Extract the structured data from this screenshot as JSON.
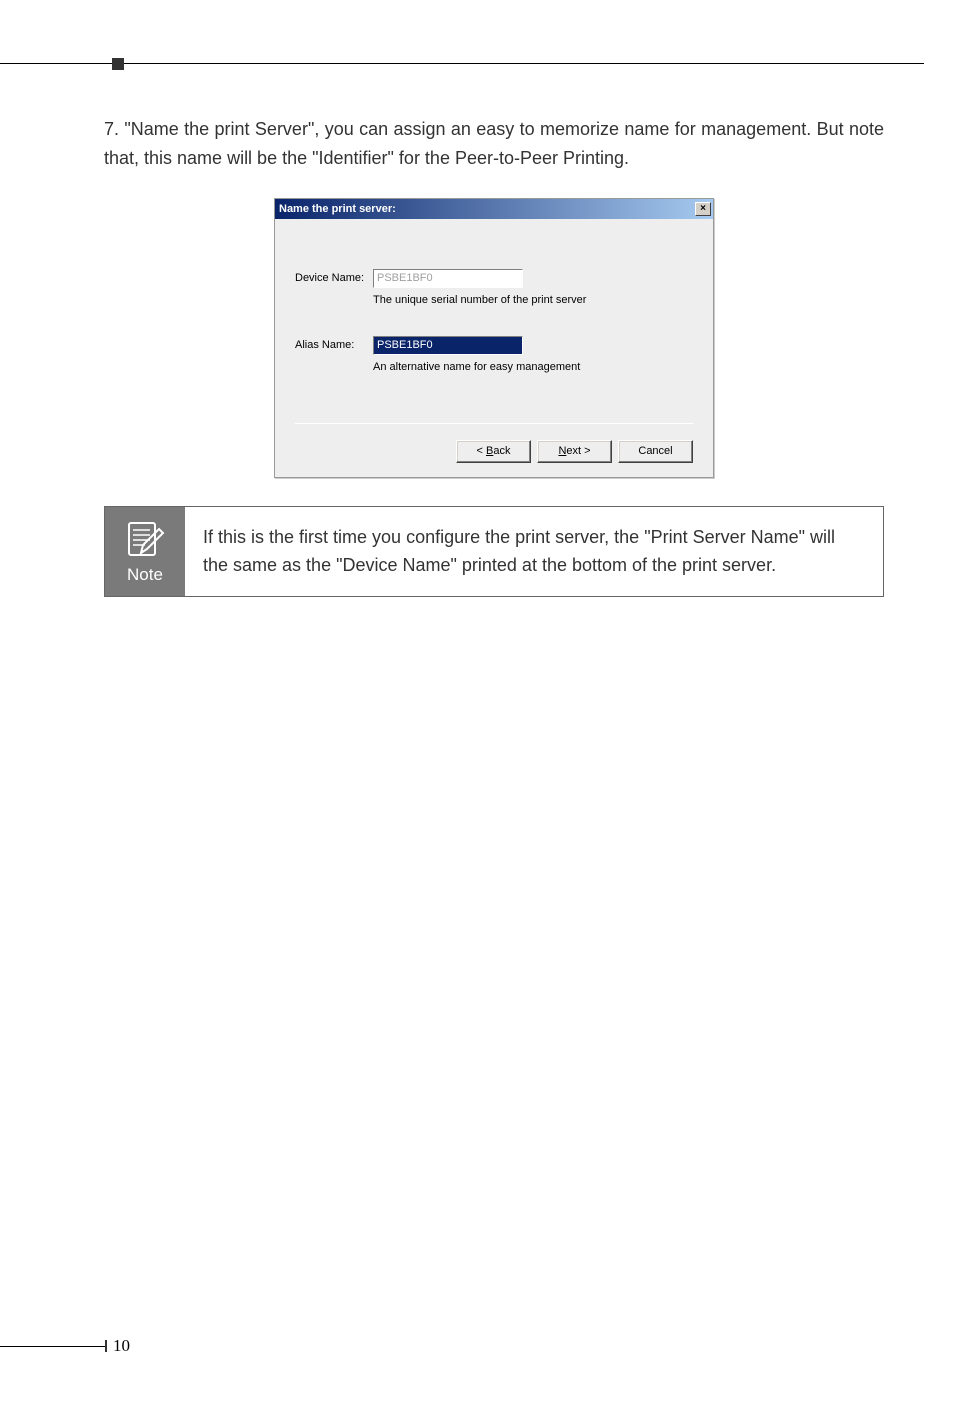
{
  "instruction": {
    "number": "7.",
    "text": "\"Name the print Server\", you can assign an easy to memorize name for management. But note that, this name will be the \"Identifier\" for the Peer-to-Peer Printing."
  },
  "dialog": {
    "title": "Name the print server:",
    "close_glyph": "×",
    "device_name_label": "Device Name:",
    "device_name_value": "PSBE1BF0",
    "device_name_hint": "The unique serial number of the print server",
    "alias_name_label": "Alias Name:",
    "alias_name_value": "PSBE1BF0",
    "alias_name_hint": "An alternative name for easy management",
    "back_prefix": "< ",
    "back_u": "B",
    "back_suffix": "ack",
    "next_u": "N",
    "next_suffix": "ext >",
    "cancel_label": "Cancel"
  },
  "note": {
    "label": "Note",
    "text": "If this is the first time you configure the print server, the \"Print Server Name\" will the same as the \"Device Name\" printed at the bottom of the print server."
  },
  "page_number": "10"
}
